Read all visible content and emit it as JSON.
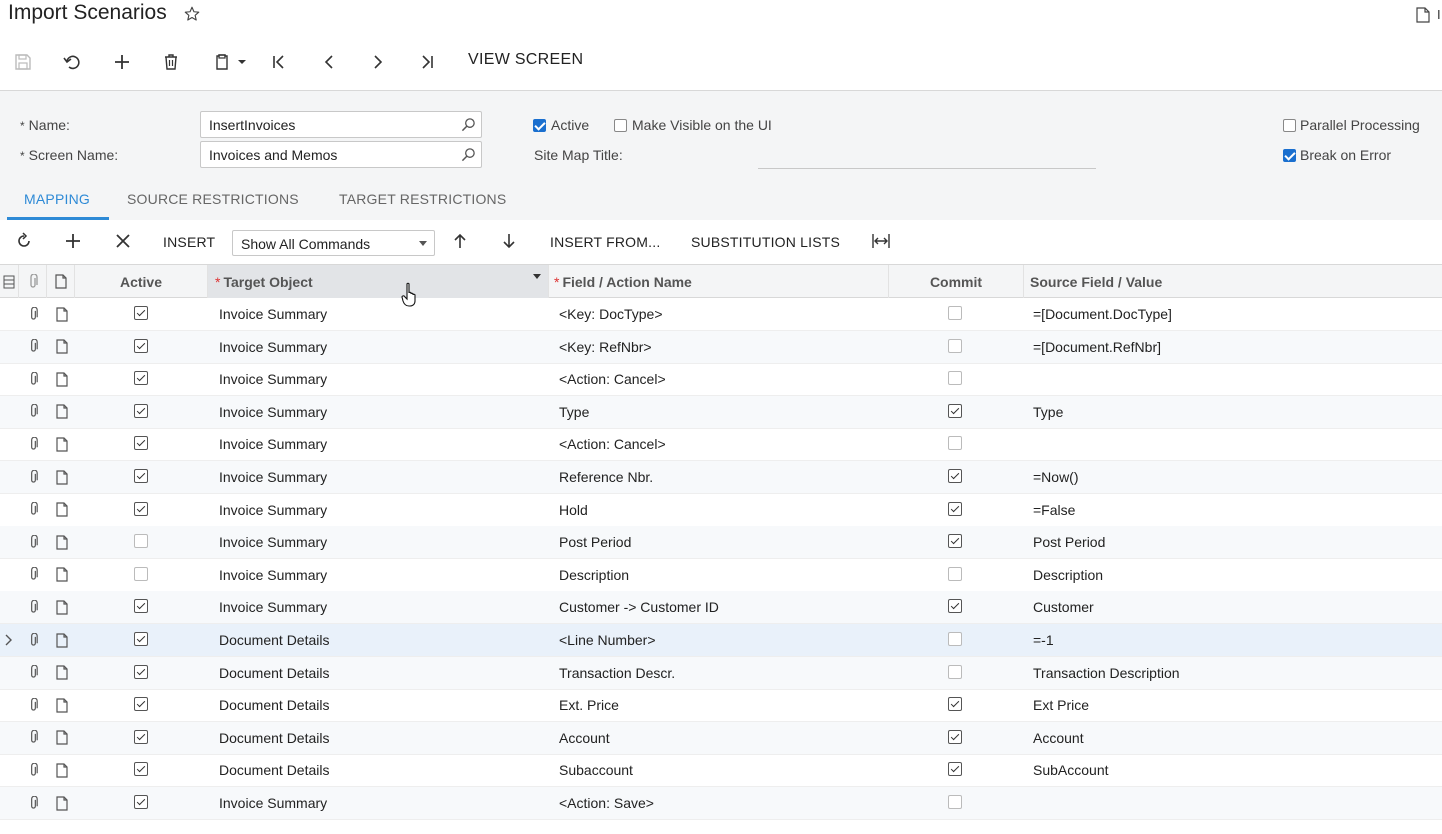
{
  "title": {
    "text": "Import Scenarios",
    "corner_text": "I"
  },
  "toolbar": {
    "view_screen_label": "VIEW SCREEN",
    "icons": [
      "save-icon",
      "undo-icon",
      "add-icon",
      "delete-icon",
      "clipboard-icon",
      "first-record-icon",
      "previous-record-icon",
      "next-record-icon",
      "last-record-icon"
    ]
  },
  "form": {
    "name_label": "Name:",
    "name_value": "InsertInvoices",
    "screen_name_label": "Screen Name:",
    "screen_name_value": "Invoices and Memos",
    "active_label": "Active",
    "active_checked": true,
    "make_visible_label": "Make Visible on the UI",
    "make_visible_checked": false,
    "site_map_title_label": "Site Map Title:",
    "site_map_title_value": "",
    "parallel_processing_label": "Parallel Processing",
    "parallel_processing_checked": false,
    "break_on_error_label": "Break on Error",
    "break_on_error_checked": true
  },
  "tabs": [
    {
      "label": "MAPPING",
      "active": true
    },
    {
      "label": "SOURCE RESTRICTIONS",
      "active": false
    },
    {
      "label": "TARGET RESTRICTIONS",
      "active": false
    }
  ],
  "grid_toolbar": {
    "insert_label": "INSERT",
    "command_filter_value": "Show All Commands",
    "insert_from_label": "INSERT FROM...",
    "substitution_lists_label": "SUBSTITUTION LISTS"
  },
  "grid": {
    "columns": {
      "active": "Active",
      "target_object": "Target Object",
      "field_action": "Field / Action Name",
      "commit": "Commit",
      "source_field": "Source Field / Value"
    },
    "rows": [
      {
        "active": true,
        "target": "Invoice Summary",
        "field": "<Key: DocType>",
        "commit": false,
        "source": "=[Document.DocType]"
      },
      {
        "active": true,
        "target": "Invoice Summary",
        "field": "<Key: RefNbr>",
        "commit": false,
        "source": "=[Document.RefNbr]"
      },
      {
        "active": true,
        "target": "Invoice Summary",
        "field": "<Action: Cancel>",
        "commit": false,
        "source": ""
      },
      {
        "active": true,
        "target": "Invoice Summary",
        "field": "Type",
        "commit": true,
        "source": "Type"
      },
      {
        "active": true,
        "target": "Invoice Summary",
        "field": "<Action: Cancel>",
        "commit": false,
        "source": ""
      },
      {
        "active": true,
        "target": "Invoice Summary",
        "field": "Reference Nbr.",
        "commit": true,
        "source": "=Now()"
      },
      {
        "active": true,
        "target": "Invoice Summary",
        "field": "Hold",
        "commit": true,
        "source": "=False"
      },
      {
        "active": false,
        "target": "Invoice Summary",
        "field": "Post Period",
        "commit": true,
        "source": "Post Period"
      },
      {
        "active": false,
        "target": "Invoice Summary",
        "field": "Description",
        "commit": false,
        "source": "Description"
      },
      {
        "active": true,
        "target": "Invoice Summary",
        "field": "Customer -> Customer ID",
        "commit": true,
        "source": "Customer"
      },
      {
        "active": true,
        "target": "Document Details",
        "field": "<Line Number>",
        "commit": false,
        "source": "=-1",
        "selected": true
      },
      {
        "active": true,
        "target": "Document Details",
        "field": "Transaction Descr.",
        "commit": false,
        "source": "Transaction Description"
      },
      {
        "active": true,
        "target": "Document Details",
        "field": "Ext. Price",
        "commit": true,
        "source": "Ext Price"
      },
      {
        "active": true,
        "target": "Document Details",
        "field": "Account",
        "commit": true,
        "source": "Account"
      },
      {
        "active": true,
        "target": "Document Details",
        "field": "Subaccount",
        "commit": true,
        "source": "SubAccount"
      },
      {
        "active": true,
        "target": "Invoice Summary",
        "field": "<Action: Save>",
        "commit": false,
        "source": ""
      }
    ]
  }
}
